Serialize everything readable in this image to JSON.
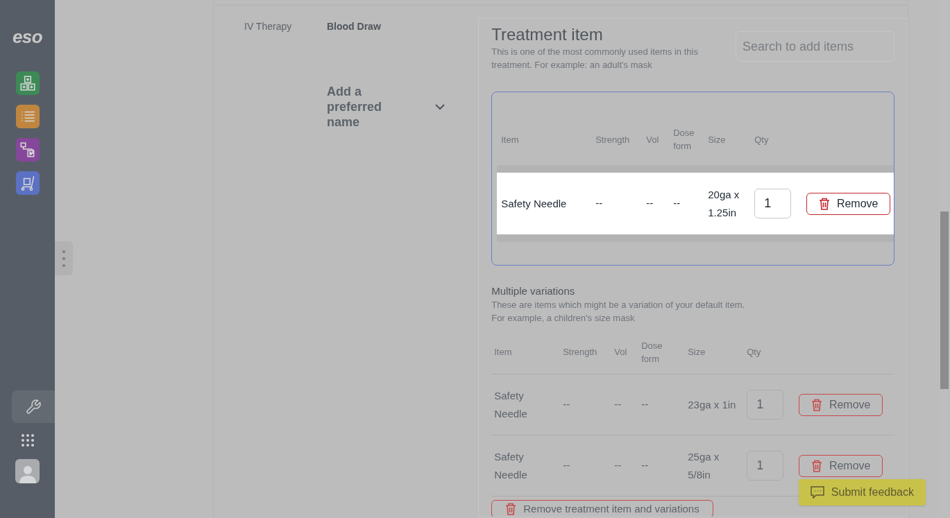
{
  "sidebar": {
    "logo": "eso",
    "apps": [
      {
        "kind": "blocks",
        "color": "#3d8a57"
      },
      {
        "kind": "list",
        "color": "#c08640"
      },
      {
        "kind": "flow",
        "color": "#85479a"
      },
      {
        "kind": "cart",
        "color": "#5b71c4"
      }
    ],
    "tools": [
      {
        "kind": "wrench",
        "selected": true
      },
      {
        "kind": "grid",
        "selected": false
      },
      {
        "kind": "avatar",
        "selected": false
      }
    ]
  },
  "procedure": {
    "category": "IV Therapy",
    "name": "Blood Draw",
    "preferred_name": "Add a preferred name"
  },
  "treatment_item": {
    "title": "Treatment item",
    "description": "This is one of the most commonly used items in this treatment. For example: an adult's mask",
    "search": {
      "placeholder": "Search to add items"
    },
    "columns": [
      "Item",
      "Strength",
      "Vol",
      "Dose form",
      "Size",
      "Qty"
    ],
    "rows": [
      {
        "item": "Safety Needle",
        "strength": "--",
        "vol": "--",
        "dose_form": "--",
        "size": "20ga x 1.25in",
        "qty": "1",
        "button": "Remove",
        "highlighted": true
      }
    ]
  },
  "variations": {
    "title": "Multiple variations",
    "description": [
      "These are items which might be a variation of your default item.",
      "For example, a children's size mask"
    ],
    "columns": [
      "Item",
      "Strength",
      "Vol",
      "Dose form",
      "Size",
      "Qty"
    ],
    "rows": [
      {
        "item": "Safety Needle",
        "strength": "--",
        "vol": "--",
        "dose_form": "--",
        "size": "23ga x 1in",
        "qty": "1",
        "button": "Remove",
        "highlighted": false
      },
      {
        "item": "Safety Needle",
        "strength": "--",
        "vol": "--",
        "dose_form": "--",
        "size": "25ga x 5/8in",
        "qty": "1",
        "button": "Remove",
        "highlighted": false
      }
    ]
  },
  "remove_all_button": "Remove treatment item and variations",
  "feedback_button": "Submit feedback"
}
